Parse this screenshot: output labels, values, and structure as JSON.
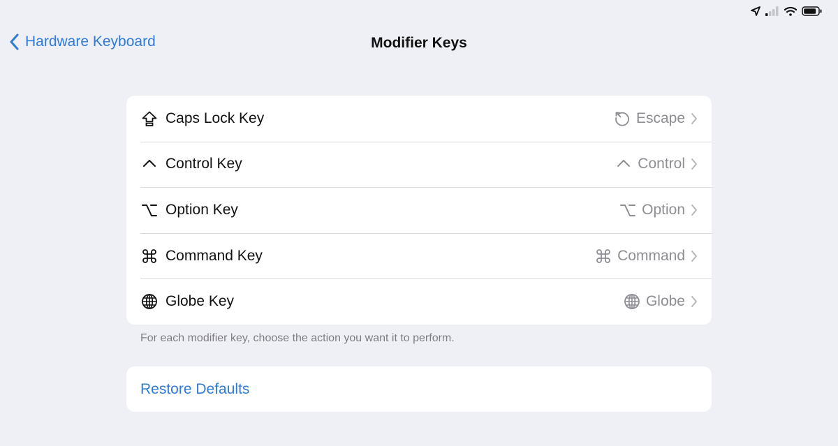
{
  "nav": {
    "back_label": "Hardware Keyboard",
    "title": "Modifier Keys"
  },
  "rows": [
    {
      "label": "Caps Lock Key",
      "icon": "caps-lock-icon",
      "value": "Escape",
      "value_icon": "escape-icon"
    },
    {
      "label": "Control Key",
      "icon": "control-icon",
      "value": "Control",
      "value_icon": "control-icon"
    },
    {
      "label": "Option Key",
      "icon": "option-icon",
      "value": "Option",
      "value_icon": "option-icon"
    },
    {
      "label": "Command Key",
      "icon": "command-icon",
      "value": "Command",
      "value_icon": "command-icon"
    },
    {
      "label": "Globe Key",
      "icon": "globe-icon",
      "value": "Globe",
      "value_icon": "globe-icon"
    }
  ],
  "footer_note": "For each modifier key, choose the action you want it to perform.",
  "restore_label": "Restore Defaults",
  "colors": {
    "background": "#eff0f5",
    "accent": "#2f7bd8",
    "secondary_text": "#8d8d93",
    "card": "#ffffff"
  },
  "status_bar": {
    "icons": [
      "location-icon",
      "cellular-signal-icon",
      "wifi-icon",
      "battery-icon"
    ]
  }
}
